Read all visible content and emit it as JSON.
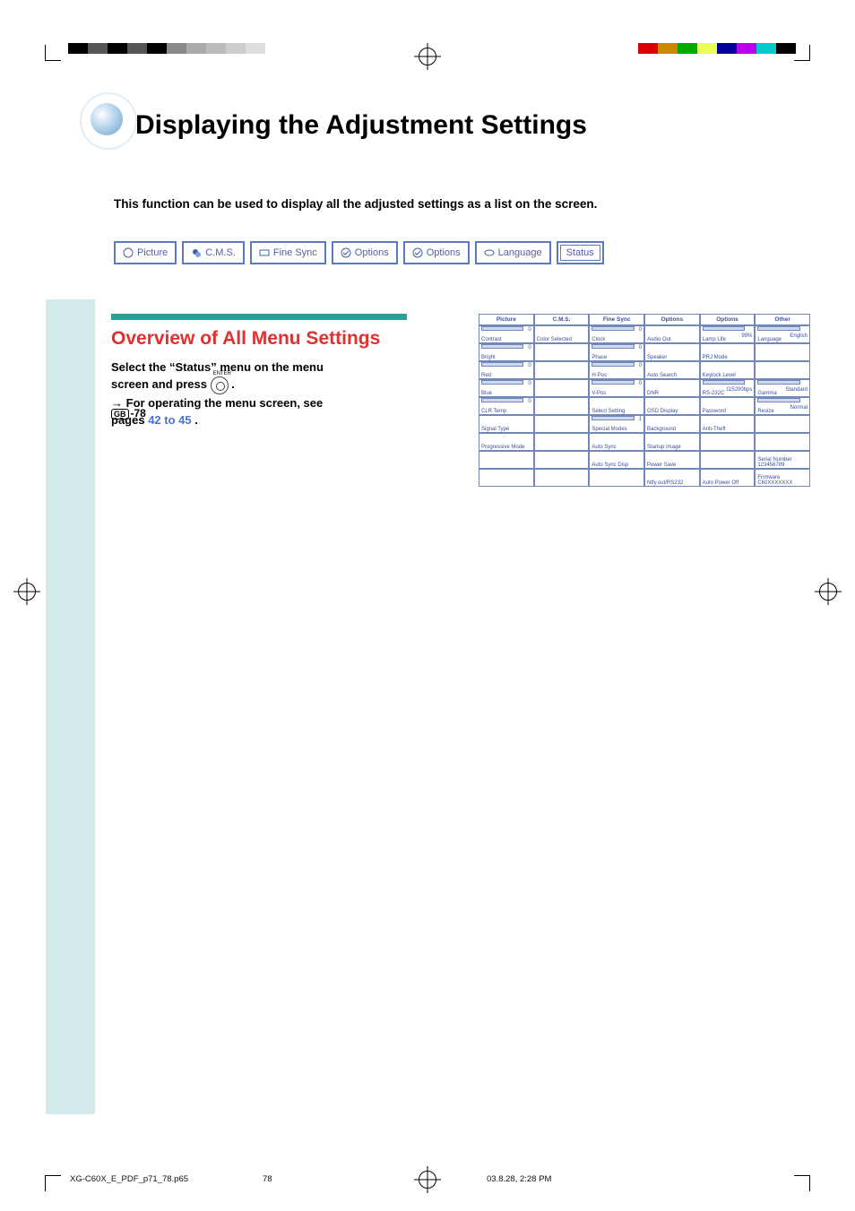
{
  "page_title": "Displaying the Adjustment Settings",
  "intro": "This function can be used to display all the adjusted settings as a list on the screen.",
  "tabs": [
    "Picture",
    "C.M.S.",
    "Fine Sync",
    "Options",
    "Options",
    "Language",
    "Status"
  ],
  "section_title": "Overview of All Menu Settings",
  "body": {
    "l1a": "Select the “Status” menu on the menu",
    "l1b": "screen and press ",
    "l1c": " .",
    "enter_label": "ENTER",
    "l2a": "→ ",
    "l2b": "For operating the menu screen, see",
    "l3a": "pages ",
    "link": "42 to 45",
    "l3b": "."
  },
  "status_headers": [
    "Picture",
    "C.M.S.",
    "Fine Sync",
    "Options",
    "Options",
    "Other"
  ],
  "status_rows": [
    [
      "Contrast|0",
      "Color Selected",
      "Clock|0",
      "Audio Out",
      "Lamp Life|99%",
      "Language|English"
    ],
    [
      "Bright|0",
      "",
      "Phase|0",
      "Speaker",
      "PRJ Mode",
      ""
    ],
    [
      "Red|0",
      "",
      "H-Pos|0",
      "Auto Search",
      "Keylock Level",
      ""
    ],
    [
      "Blue|0",
      "",
      "V-Pos|0",
      "DNR",
      "RS-232C|115200bps",
      "Gamma|Standard"
    ],
    [
      "CLR Temp|0",
      "",
      "Select Setting",
      "OSD Display",
      "Password",
      "Resize|Normal"
    ],
    [
      "Signal Type",
      "",
      "Special Modes|1",
      "Background",
      "Anti-Theft",
      ""
    ],
    [
      "Progressive Mode",
      "",
      "Auto Sync",
      "Startup Image",
      "",
      ""
    ],
    [
      "",
      "",
      "Auto Sync Disp",
      "Power Save",
      "",
      "Serial Number\n123456789"
    ],
    [
      "",
      "",
      "",
      "Ntfy.out/RS232",
      "Auto Power Off",
      "Firmware\nC60XXXXXXX"
    ]
  ],
  "page_number": "-78",
  "print_footer": {
    "file": "XG-C60X_E_PDF_p71_78.p65",
    "page": "78",
    "date": "03.8.28, 2:28 PM"
  }
}
